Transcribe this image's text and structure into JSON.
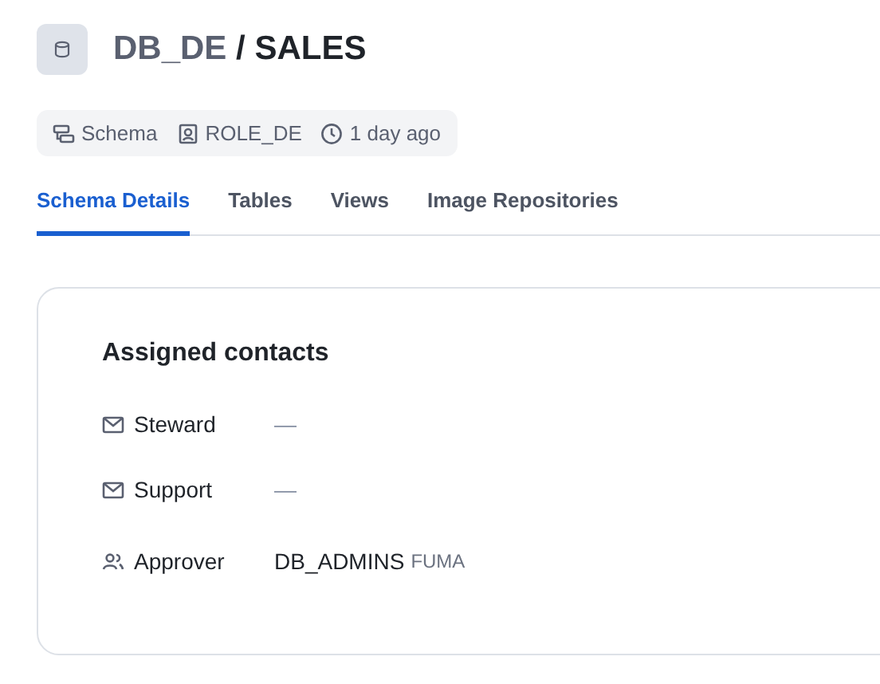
{
  "header": {
    "database": "DB_DE",
    "separator": "/",
    "schema": "SALES"
  },
  "meta": [
    {
      "kind": "schema",
      "label": "Schema"
    },
    {
      "kind": "role",
      "label": "ROLE_DE"
    },
    {
      "kind": "time",
      "label": "1 day ago"
    }
  ],
  "tabs": [
    {
      "label": "Schema Details",
      "selected": true
    },
    {
      "label": "Tables",
      "selected": false
    },
    {
      "label": "Views",
      "selected": false
    },
    {
      "label": "Image Repositories",
      "selected": false
    }
  ],
  "contacts": {
    "title": "Assigned contacts",
    "rows": [
      {
        "kind": "email",
        "label": "Steward",
        "value": "—"
      },
      {
        "kind": "email",
        "label": "Support",
        "value": "—"
      },
      {
        "kind": "group",
        "label": "Approver",
        "value": "DB_ADMINS",
        "tag": "FUMA"
      }
    ]
  }
}
